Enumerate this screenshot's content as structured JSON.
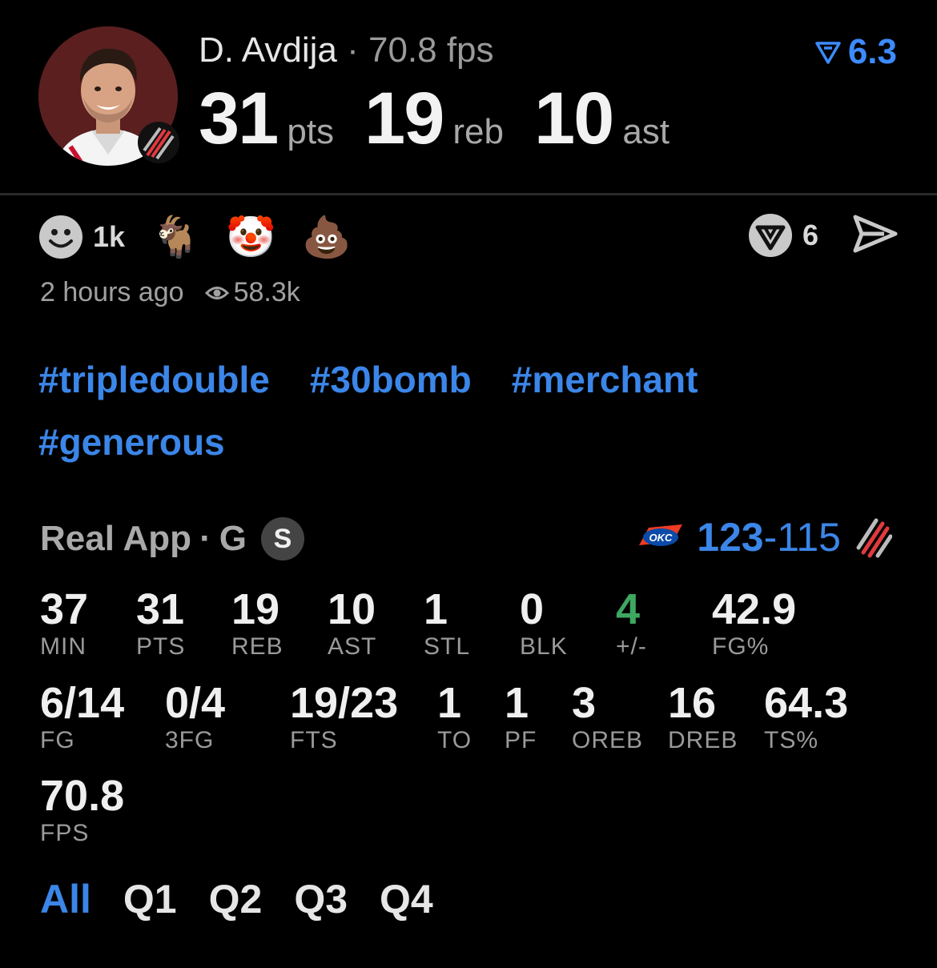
{
  "header": {
    "player_name": "D. Avdija",
    "separator": "·",
    "fps_text": "70.8 fps",
    "rating": "6.3",
    "big_stats": [
      {
        "value": "31",
        "label": "pts"
      },
      {
        "value": "19",
        "label": "reb"
      },
      {
        "value": "10",
        "label": "ast"
      }
    ]
  },
  "reactions": {
    "items": [
      {
        "icon": "smiley-icon",
        "count": "1k"
      },
      {
        "icon": "goat-emoji",
        "emoji": "🐐"
      },
      {
        "icon": "clown-emoji",
        "emoji": "🤡"
      },
      {
        "icon": "poop-emoji",
        "emoji": "💩"
      }
    ],
    "comments_count": "6",
    "share_icon": "send-icon"
  },
  "meta": {
    "time": "2 hours ago",
    "views": "58.3k"
  },
  "hashtags": [
    "#tripledouble",
    "#30bomb",
    "#merchant",
    "#generous"
  ],
  "game": {
    "source": "Real App",
    "separator": "·",
    "position": "G",
    "badge": "S",
    "score_win": "123",
    "score_dash": "-",
    "score_loss": "115",
    "opponent_logo_text": "OKC"
  },
  "stats": {
    "row1": [
      {
        "value": "37",
        "label": "MIN"
      },
      {
        "value": "31",
        "label": "PTS"
      },
      {
        "value": "19",
        "label": "REB"
      },
      {
        "value": "10",
        "label": "AST"
      },
      {
        "value": "1",
        "label": "STL"
      },
      {
        "value": "0",
        "label": "BLK"
      },
      {
        "value": "4",
        "label": "+/-"
      },
      {
        "value": "42.9",
        "label": "FG%"
      }
    ],
    "row2": [
      {
        "value": "6/14",
        "label": "FG"
      },
      {
        "value": "0/4",
        "label": "3FG"
      },
      {
        "value": "19/23",
        "label": "FTS"
      },
      {
        "value": "1",
        "label": "TO"
      },
      {
        "value": "1",
        "label": "PF"
      },
      {
        "value": "3",
        "label": "OREB"
      },
      {
        "value": "16",
        "label": "DREB"
      },
      {
        "value": "64.3",
        "label": "TS%"
      }
    ],
    "row3": [
      {
        "value": "70.8",
        "label": "FPS"
      }
    ]
  },
  "tabs": [
    "All",
    "Q1",
    "Q2",
    "Q3",
    "Q4"
  ],
  "colors": {
    "accent": "#3b86e8",
    "positive": "#3ea860",
    "background": "#000000"
  }
}
